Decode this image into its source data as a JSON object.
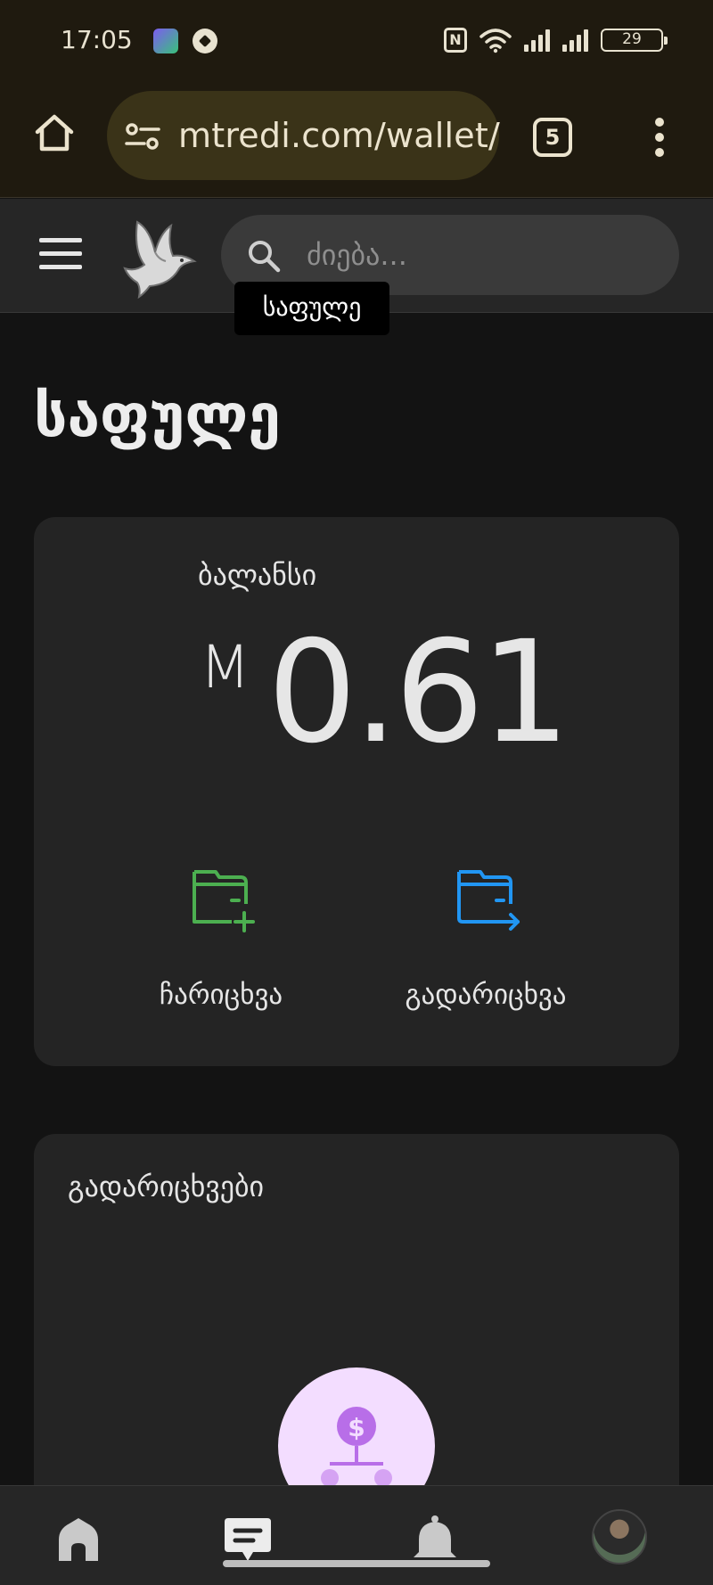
{
  "status_bar": {
    "time": "17:05",
    "battery": "29",
    "icons": [
      "wallet-app-icon",
      "football-icon",
      "nfc-icon",
      "wifi-icon",
      "signal-icon",
      "signal-icon",
      "battery-icon"
    ]
  },
  "browser": {
    "url": "mtredi.com/wallet/",
    "tab_count": "5"
  },
  "header": {
    "search_placeholder": "ძიება...",
    "tooltip": "საფულე"
  },
  "page": {
    "title": "საფულე"
  },
  "balance": {
    "label": "ბალანსი",
    "currency_symbol": "M",
    "amount": "0.61",
    "actions": [
      {
        "label": "ჩარიცხვა",
        "icon": "wallet-add-icon",
        "color": "#4caf50"
      },
      {
        "label": "გადარიცხვა",
        "icon": "wallet-transfer-icon",
        "color": "#2196f3"
      }
    ]
  },
  "transactions": {
    "title": "გადარიცხვები"
  },
  "bottom_nav": {
    "items": [
      "home-icon",
      "chat-icon",
      "bell-icon",
      "profile-avatar"
    ]
  },
  "colors": {
    "background": "#131313",
    "card": "#242424",
    "browser_bar": "#1f1a0f",
    "deposit": "#4caf50",
    "transfer": "#2196f3",
    "empty_state_bg": "#f3ddff",
    "empty_state_icon": "#b86ee8"
  }
}
